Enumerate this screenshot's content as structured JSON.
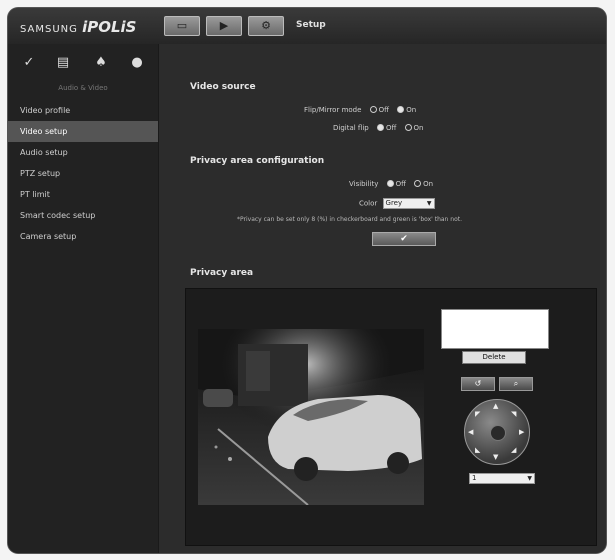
{
  "header": {
    "brand_small": "SAMSUNG",
    "brand_big": "iPOLiS",
    "page_title": "Setup",
    "buttons": [
      {
        "icon": "monitor-icon"
      },
      {
        "icon": "playback-icon"
      },
      {
        "icon": "setup-icon"
      }
    ]
  },
  "sidebar": {
    "icons": [
      "camera-setup-icon",
      "document-icon",
      "bell-icon",
      "user-icon"
    ],
    "heading": "Audio & Video",
    "items": [
      {
        "label": "Video profile",
        "active": false
      },
      {
        "label": "Video setup",
        "active": true
      },
      {
        "label": "Audio setup",
        "active": false
      },
      {
        "label": "PTZ setup",
        "active": false
      },
      {
        "label": "PT limit",
        "active": false
      },
      {
        "label": "Smart codec setup",
        "active": false
      },
      {
        "label": "Camera setup",
        "active": false
      }
    ]
  },
  "video_source": {
    "title": "Video source",
    "flip_label": "Flip/Mirror mode",
    "flip_options": [
      "Off",
      "On"
    ],
    "flip_selected": "On",
    "digital_label": "Digital flip",
    "digital_options": [
      "Off",
      "On"
    ],
    "digital_selected": "Off"
  },
  "privacy_config": {
    "title": "Privacy area configuration",
    "visibility_label": "Visibility",
    "visibility_options": [
      "Off",
      "On"
    ],
    "visibility_selected": "Off",
    "color_label": "Color",
    "color_value": "Grey",
    "note": "*Privacy can be set only 8 (%) in checkerboard and green is 'box' than not.",
    "apply_label": "✔"
  },
  "privacy_area": {
    "title": "Privacy area",
    "delete_label": "Delete",
    "preset_value": "1"
  }
}
